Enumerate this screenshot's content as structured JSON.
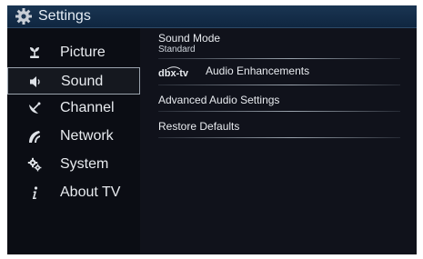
{
  "header": {
    "title": "Settings",
    "icon": "gear-icon"
  },
  "sidebar": {
    "items": [
      {
        "label": "Picture",
        "icon": "picture-icon",
        "selected": false
      },
      {
        "label": "Sound",
        "icon": "speaker-icon",
        "selected": true
      },
      {
        "label": "Channel",
        "icon": "satellite-dish-icon",
        "selected": false
      },
      {
        "label": "Network",
        "icon": "network-icon",
        "selected": false
      },
      {
        "label": "System",
        "icon": "system-gear-icon",
        "selected": false
      },
      {
        "label": "About TV",
        "icon": "info-icon",
        "selected": false
      }
    ]
  },
  "sound_options": {
    "sound_mode": {
      "label": "Sound Mode",
      "value": "Standard"
    },
    "audio_enhancements": {
      "logo_text": "dbx-tv",
      "label": "Audio Enhancements"
    },
    "advanced_audio": {
      "label": "Advanced Audio Settings"
    },
    "restore_defaults": {
      "label": "Restore Defaults"
    }
  },
  "colors": {
    "title_bar": "#1a3552",
    "screen_background": "#05050a",
    "text": "#e8ebef",
    "selection_border": "#9aa3ad"
  }
}
